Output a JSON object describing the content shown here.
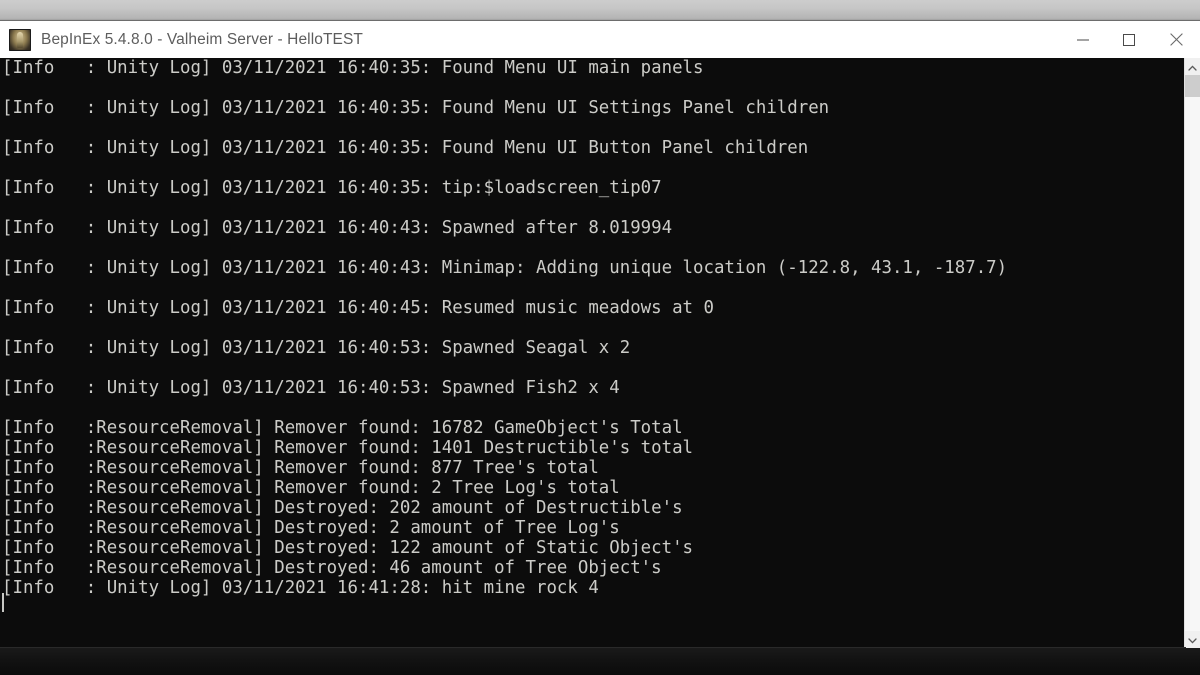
{
  "window": {
    "title": "BepInEx 5.4.8.0 - Valheim Server - HelloTEST",
    "icon": "valheim-app-icon",
    "controls": {
      "minimize": "minimize-icon",
      "maximize": "maximize-icon",
      "close": "close-icon"
    }
  },
  "scrollbar": {
    "up_arrow": "chevron-up-icon",
    "down_arrow": "chevron-down-icon"
  },
  "console": {
    "lines": [
      "[Info   : Unity Log] 03/11/2021 16:40:35: Found Menu UI main panels",
      "",
      "[Info   : Unity Log] 03/11/2021 16:40:35: Found Menu UI Settings Panel children",
      "",
      "[Info   : Unity Log] 03/11/2021 16:40:35: Found Menu UI Button Panel children",
      "",
      "[Info   : Unity Log] 03/11/2021 16:40:35: tip:$loadscreen_tip07",
      "",
      "[Info   : Unity Log] 03/11/2021 16:40:43: Spawned after 8.019994",
      "",
      "[Info   : Unity Log] 03/11/2021 16:40:43: Minimap: Adding unique location (-122.8, 43.1, -187.7)",
      "",
      "[Info   : Unity Log] 03/11/2021 16:40:45: Resumed music meadows at 0",
      "",
      "[Info   : Unity Log] 03/11/2021 16:40:53: Spawned Seagal x 2",
      "",
      "[Info   : Unity Log] 03/11/2021 16:40:53: Spawned Fish2 x 4",
      "",
      "[Info   :ResourceRemoval] Remover found: 16782 GameObject's Total",
      "[Info   :ResourceRemoval] Remover found: 1401 Destructible's total",
      "[Info   :ResourceRemoval] Remover found: 877 Tree's total",
      "[Info   :ResourceRemoval] Remover found: 2 Tree Log's total",
      "[Info   :ResourceRemoval] Destroyed: 202 amount of Destructible's",
      "[Info   :ResourceRemoval] Destroyed: 2 amount of Tree Log's",
      "[Info   :ResourceRemoval] Destroyed: 122 amount of Static Object's",
      "[Info   :ResourceRemoval] Destroyed: 46 amount of Tree Object's",
      "[Info   : Unity Log] 03/11/2021 16:41:28: hit mine rock 4"
    ]
  },
  "colors": {
    "console_background": "#0c0c0c",
    "console_text": "#ccccc8",
    "titlebar_background": "#ffffff",
    "title_text": "#5d5d5d",
    "scrollbar_track": "#f7f7f7",
    "scrollbar_thumb": "#cdcdcd"
  }
}
